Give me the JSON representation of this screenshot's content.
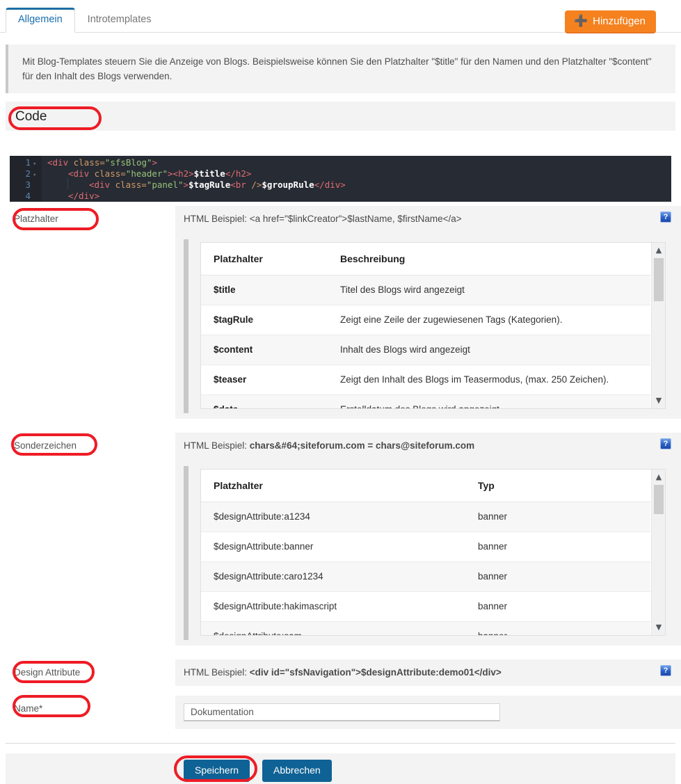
{
  "tabs": [
    {
      "label": "Allgemein",
      "active": true
    },
    {
      "label": "Introtemplates",
      "active": false
    }
  ],
  "toolbar": {
    "add_label": "Hinzufügen",
    "add_icon": "plus-icon",
    "add_color": "#f5821f"
  },
  "hint": {
    "text": "Mit Blog-Templates steuern Sie die Anzeige von Blogs. Beispielsweise können Sie den Platzhalter \"$title\" für den Namen und den Platzhalter \"$content\" für den Inhalt des Blogs verwenden."
  },
  "code_section": {
    "heading": "Code",
    "editor": {
      "lines": [
        {
          "number": "1",
          "foldable": true,
          "indent": 0
        },
        {
          "number": "2",
          "foldable": true,
          "indent": 1
        },
        {
          "number": "3",
          "foldable": false,
          "indent": 2
        },
        {
          "number": "4",
          "foldable": false,
          "indent": 1
        }
      ],
      "line1": "<div class=\"sfsBlog\">",
      "line2": "    <div class=\"header\"><h2>$title</h2>",
      "line3": "        <div class=\"panel\">$tagRule<br />$groupRule</div>",
      "line4": "    </div>",
      "tokens": {
        "l1_a": "<div",
        "l1_b": " class=",
        "l1_c": "\"sfsBlog\"",
        "l1_d": ">",
        "l2_a": "<div",
        "l2_b": " class=",
        "l2_c": "\"header\"",
        "l2_d": "><h2>",
        "l2_e": "$title",
        "l2_f": "</h2>",
        "l3_a": "<div",
        "l3_b": " class=",
        "l3_c": "\"panel\"",
        "l3_d": ">",
        "l3_e": "$tagRule",
        "l3_f": "<br",
        "l3_g": " />",
        "l3_h": "$groupRule",
        "l3_i": "</div>",
        "l4_a": "</div>"
      }
    }
  },
  "placeholder_section": {
    "label": "Platzhalter",
    "example_prefix": "HTML Beispiel: ",
    "example_code": "<a href=\"$linkCreator\">$lastName, $firstName</a>",
    "help_icon": "help-icon",
    "table": {
      "columns": [
        "Platzhalter",
        "Beschreibung"
      ],
      "rows": [
        {
          "key": "$title",
          "value": "Titel des Blogs wird angezeigt"
        },
        {
          "key": "$tagRule",
          "value": "Zeigt eine Zeile der zugewiesenen Tags (Kategorien)."
        },
        {
          "key": "$content",
          "value": "Inhalt des Blogs wird angezeigt"
        },
        {
          "key": "$teaser",
          "value": "Zeigt den Inhalt des Blogs im Teasermodus, (max. 250 Zeichen)."
        },
        {
          "key": "$date",
          "value": "Erstelldatum des Blogs wird angezeigt"
        }
      ],
      "scroll_up_icon": "chevron-up-icon",
      "scroll_down_icon": "chevron-down-icon"
    }
  },
  "special_chars_section": {
    "label": "Sonderzeichen",
    "example_prefix": "HTML Beispiel: ",
    "example_code": "chars&#64;siteforum.com = chars@siteforum.com",
    "help_icon": "help-icon",
    "table": {
      "columns": [
        "Platzhalter",
        "Typ"
      ],
      "rows": [
        {
          "key": "$designAttribute:a1234",
          "value": "banner"
        },
        {
          "key": "$designAttribute:banner",
          "value": "banner"
        },
        {
          "key": "$designAttribute:caro1234",
          "value": "banner"
        },
        {
          "key": "$designAttribute:hakimascript",
          "value": "banner"
        },
        {
          "key": "$designAttribute:sam",
          "value": "banner"
        }
      ],
      "scroll_up_icon": "chevron-up-icon",
      "scroll_down_icon": "chevron-down-icon"
    }
  },
  "design_attribute_section": {
    "label": "Design Attribute",
    "example_prefix": "HTML Beispiel: ",
    "example_code": "<div id=\"sfsNavigation\">$designAttribute:demo01</div>",
    "help_icon": "help-icon"
  },
  "name_section": {
    "label": "Name*",
    "value": "Dokumentation",
    "placeholder": "Dokumentation"
  },
  "footer": {
    "save_label": "Speichern",
    "cancel_label": "Abbrechen",
    "button_color": "#0f6295"
  },
  "annotations": {
    "color": "#ee1c25",
    "targets": [
      "Code",
      "Platzhalter",
      "Sonderzeichen",
      "Design Attribute",
      "Name*",
      "Speichern"
    ]
  }
}
